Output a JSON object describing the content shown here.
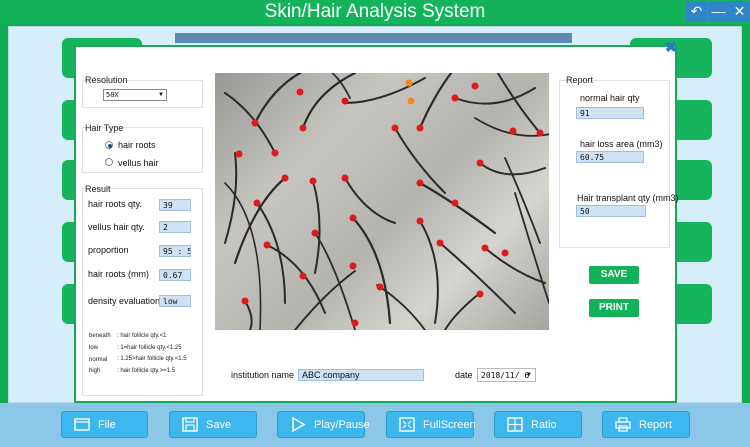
{
  "window": {
    "title": "Skin/Hair Analysis System",
    "controls": [
      "back-icon",
      "minimize-icon",
      "close-icon"
    ]
  },
  "resolution": {
    "title": "Resolution",
    "selected": "50X"
  },
  "hair_type": {
    "title": "Hair Type",
    "options": [
      {
        "label": "hair roots",
        "selected": true
      },
      {
        "label": "vellus hair",
        "selected": false
      }
    ]
  },
  "result": {
    "title": "Result",
    "rows": [
      {
        "label": "hair roots qty.",
        "value": "39"
      },
      {
        "label": "vellus hair qty.",
        "value": "2"
      },
      {
        "label": "proportion",
        "value": "95 : 5"
      },
      {
        "label": "hair roots (mm)",
        "value": "0.67"
      },
      {
        "label": "density evaluation",
        "value": "low"
      }
    ],
    "legend": [
      {
        "key": "beneath",
        "desc": ": hair follicle qty.<1"
      },
      {
        "key": "low",
        "desc": ": 1=hair follicle qty.<1.25"
      },
      {
        "key": "normal",
        "desc": ": 1.25>hair follicle qty.<1.5"
      },
      {
        "key": "high",
        "desc": ": hair follicle qty.>=1.5"
      }
    ]
  },
  "report": {
    "title": "Report",
    "fields": [
      {
        "label": "normal hair qty",
        "value": "91"
      },
      {
        "label": "hair loss area (mm3)",
        "value": "60.75"
      },
      {
        "label": "Hair transplant qty (mm3)",
        "value": "50"
      }
    ],
    "save_label": "SAVE",
    "print_label": "PRINT"
  },
  "footer": {
    "institution_label": "institution name",
    "institution_value": "ABC company",
    "date_label": "date",
    "date_value": "2018/11/ 6"
  },
  "toolbar": {
    "buttons": [
      {
        "label": "File",
        "icon": "folder-icon"
      },
      {
        "label": "Save",
        "icon": "save-icon"
      },
      {
        "label": "Play/Pause",
        "icon": "play-icon"
      },
      {
        "label": "FullScreen",
        "icon": "fullscreen-icon"
      },
      {
        "label": "Ratio",
        "icon": "ratio-icon"
      },
      {
        "label": "Report",
        "icon": "printer-icon"
      }
    ]
  },
  "colors": {
    "brand_green": "#12b35a",
    "accent_blue": "#3eb6ee",
    "marker_red": "#e0191b",
    "marker_orange": "#f08a16"
  }
}
